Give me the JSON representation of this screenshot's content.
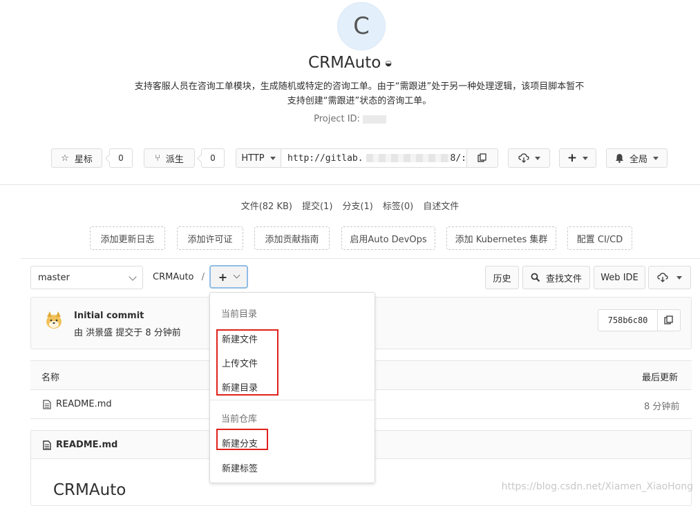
{
  "project": {
    "avatar_letter": "C",
    "name": "CRMAuto",
    "visibility_icon": "shield-icon",
    "description_line1": "支持客服人员在咨询工单模块，生成随机或特定的咨询工单。由于“需跟进”处于另一种处理逻辑，该项目脚本暂不",
    "description_line2": "支持创建“需跟进”状态的咨询工单。",
    "id_label": "Project ID:"
  },
  "actions": {
    "star_label": "星标",
    "star_count": "0",
    "fork_label": "派生",
    "fork_count": "0",
    "protocol": "HTTP",
    "clone_url_prefix": "http://gitlab.",
    "clone_url_suffix": "8/:",
    "notification_label": "全局"
  },
  "stats": {
    "files": "文件(82 KB)",
    "commits": "提交(1)",
    "branches": "分支(1)",
    "tags": "标签(0)",
    "readme": "自述文件"
  },
  "quick_actions": [
    "添加更新日志",
    "添加许可证",
    "添加贡献指南",
    "启用Auto DevOps",
    "添加 Kubernetes 集群",
    "配置 CI/CD"
  ],
  "repo_nav": {
    "branch": "master",
    "breadcrumb_root": "CRMAuto",
    "separator": "/",
    "add_symbol": "+",
    "history": "历史",
    "find_file": "查找文件",
    "web_ide": "Web IDE"
  },
  "commit": {
    "title": "Initial commit",
    "meta": "由 洪景盛 提交于 8 分钟前",
    "sha": "758b6c80"
  },
  "file_table": {
    "col_name": "名称",
    "col_updated": "最后更新",
    "rows": [
      {
        "name": "README.md",
        "updated": "8 分钟前"
      }
    ]
  },
  "readme": {
    "filename": "README.md",
    "heading": "CRMAuto"
  },
  "dropdown": {
    "section1": "当前目录",
    "new_file": "新建文件",
    "upload_file": "上传文件",
    "new_dir": "新建目录",
    "section2": "当前仓库",
    "new_branch": "新建分支",
    "new_tag": "新建标签"
  },
  "watermark": "https://blog.csdn.net/Xiamen_XiaoHong",
  "colors": {
    "annotation_red": "#e0201a",
    "focus_blue": "#8fbce6",
    "avatar_bg": "#e3f0fb"
  }
}
